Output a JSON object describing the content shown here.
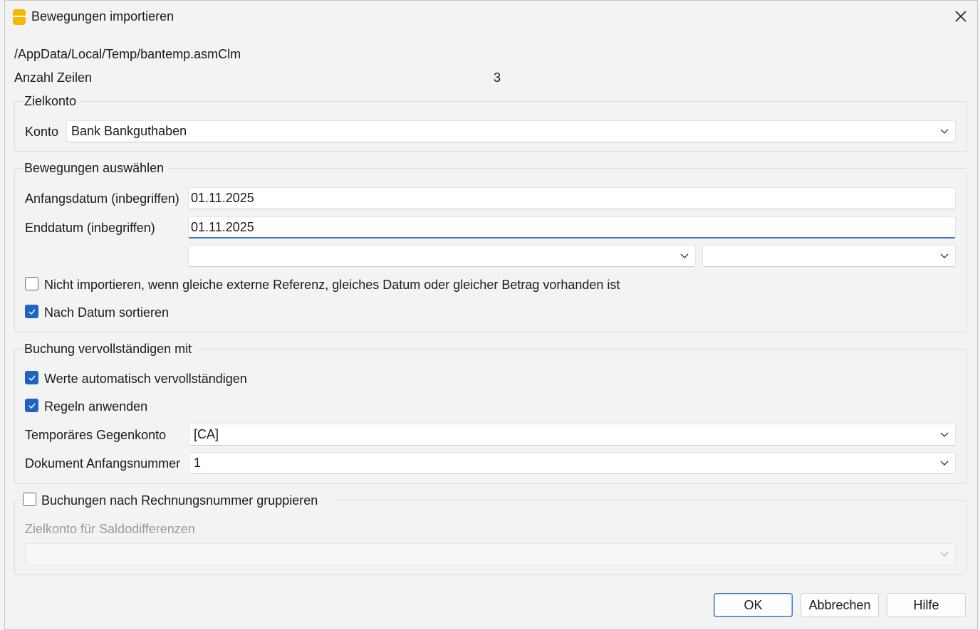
{
  "window": {
    "title": "Bewegungen importieren"
  },
  "file_path": "/AppData/Local/Temp/bantemp.asmClm",
  "row_count": {
    "label": "Anzahl Zeilen",
    "value": "3"
  },
  "zielkonto": {
    "title": "Zielkonto",
    "konto_label": "Konto",
    "konto_value": "Bank Bankguthaben"
  },
  "bewegungen": {
    "title": "Bewegungen auswählen",
    "start_label": "Anfangsdatum (inbegriffen)",
    "start_value": "01.11.2025",
    "end_label": "Enddatum (inbegriffen)",
    "end_value": "01.11.2025",
    "filter1_value": "",
    "filter2_value": "",
    "no_import_label": "Nicht importieren, wenn gleiche externe Referenz, gleiches Datum oder gleicher Betrag vorhanden ist",
    "no_import_checked": false,
    "sort_label": "Nach Datum sortieren",
    "sort_checked": true
  },
  "buchung": {
    "title": "Buchung vervollständigen mit",
    "auto_label": "Werte automatisch vervollständigen",
    "auto_checked": true,
    "rules_label": "Regeln anwenden",
    "rules_checked": true,
    "temp_label": "Temporäres Gegenkonto",
    "temp_value": "[CA]",
    "doc_label": "Dokument Anfangsnummer",
    "doc_value": "1"
  },
  "gruppieren": {
    "label": "Buchungen nach Rechnungsnummer gruppieren",
    "checked": false,
    "saldo_label": "Zielkonto für Saldodifferenzen",
    "saldo_value": ""
  },
  "buttons": {
    "ok": "OK",
    "cancel": "Abbrechen",
    "help": "Hilfe"
  },
  "colors": {
    "accent": "#1f63c4",
    "background": "#f3f3f3",
    "app_icon": "#f5b800"
  }
}
